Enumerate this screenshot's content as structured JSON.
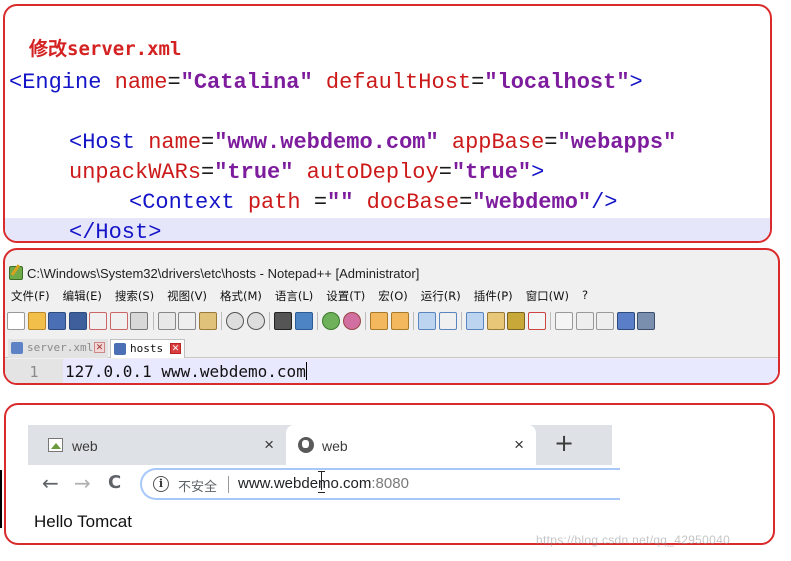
{
  "xml_panel": {
    "heading": "修改server.xml",
    "line1": {
      "open": "<Engine ",
      "attr1": "name",
      "eq1": "=",
      "val1": "\"Catalina\"",
      "attr2": " defaultHost",
      "eq2": "=",
      "val2": "\"localhost\"",
      "close": ">"
    },
    "line3": {
      "open": "<Host ",
      "attr1": "name",
      "eq1": "=",
      "val1": "\"www.webdemo.com\"",
      "attr2": " appBase",
      "eq2": "=",
      "val2": "\"webapps\""
    },
    "line4": {
      "attr1": "unpackWARs",
      "eq1": "=",
      "val1": "\"true\"",
      "attr2": " autoDeploy",
      "eq2": "=",
      "val2": "\"true\"",
      "close": ">"
    },
    "line5": {
      "open": "<Context ",
      "attr1": "path",
      "eq1": " =",
      "val1": "\"\"",
      "attr2": " docBase",
      "eq2": "=",
      "val2": "\"webdemo\"",
      "close": "/>"
    },
    "line6": {
      "close_tag": "</Host>"
    }
  },
  "notepad": {
    "title": "C:\\Windows\\System32\\drivers\\etc\\hosts - Notepad++ [Administrator]",
    "menu": [
      "文件(F)",
      "编辑(E)",
      "搜索(S)",
      "视图(V)",
      "格式(M)",
      "语言(L)",
      "设置(T)",
      "宏(O)",
      "运行(R)",
      "插件(P)",
      "窗口(W)",
      "?"
    ],
    "tabs": [
      {
        "label": "server.xml",
        "active": false,
        "close": "✕"
      },
      {
        "label": "hosts",
        "active": true,
        "close": "✕"
      }
    ],
    "line_number": "1",
    "line_text": "127.0.0.1 www.webdemo.com"
  },
  "browser": {
    "tabs": [
      {
        "label": "web",
        "close": "×",
        "icon": "image-icon"
      },
      {
        "label": "web",
        "close": "×",
        "icon": "globe-icon"
      }
    ],
    "new_tab": "+",
    "nav": {
      "back": "←",
      "forward": "→",
      "reload": "C"
    },
    "address": {
      "info": "i",
      "security_label": "不安全",
      "host": "www.webdemo.com",
      "port": ":8080"
    },
    "content": "Hello Tomcat"
  },
  "colors": {
    "frame_red": "#d92b2b",
    "xml_tag": "#1515c8",
    "xml_attr": "#cc1a1a",
    "xml_value": "#7d1d9e"
  },
  "watermark": "https://blog.csdn.net/qq_42950040"
}
